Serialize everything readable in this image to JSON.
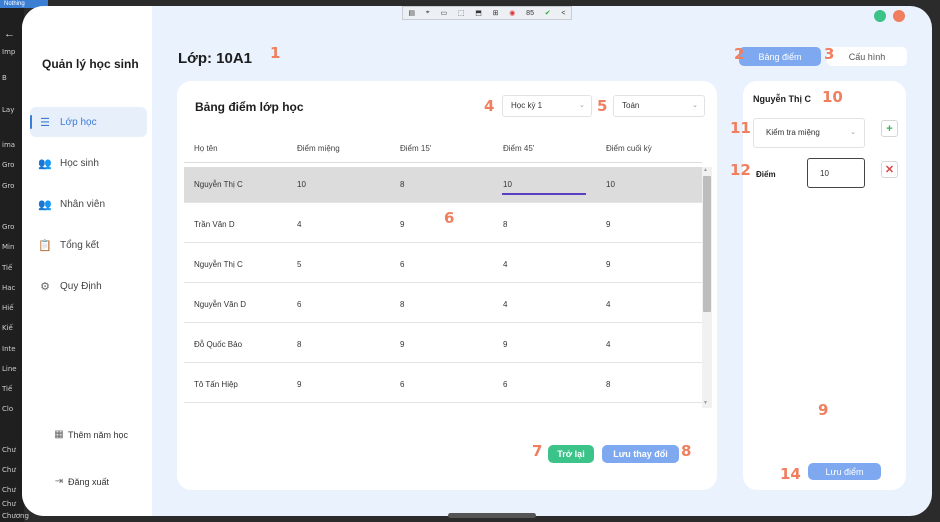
{
  "background_editor": {
    "tag": "Nothing",
    "items": [
      "Imp",
      "B",
      "Lay",
      "ima",
      "Gro",
      "Gro",
      "Gro",
      "Min",
      "Tiế",
      "Hac",
      "Hiế",
      "Kiế",
      "Inte",
      "Line",
      "Tiế",
      "Clo",
      "Chư",
      "Chư",
      "Chư",
      "Chư",
      "Chương"
    ]
  },
  "debug_toolbar": {
    "fps": "85",
    "items": [
      "▤",
      "⌖",
      "▭",
      "⬚",
      "⬒",
      "⊞",
      "◉",
      "✔",
      "<"
    ]
  },
  "window_controls": {
    "green": "#3cc389",
    "red": "#ef7f5f"
  },
  "app": {
    "title": "Quản lý học sinh"
  },
  "sidebar": {
    "items": [
      {
        "label": "Lớp học",
        "icon": "list-icon",
        "glyph": "☰",
        "active": true
      },
      {
        "label": "Học sinh",
        "icon": "student-icon",
        "glyph": "👥"
      },
      {
        "label": "Nhân viên",
        "icon": "staff-icon",
        "glyph": "👥"
      },
      {
        "label": "Tổng kết",
        "icon": "summary-icon",
        "glyph": "📋"
      },
      {
        "label": "Quy Định",
        "icon": "gear-icon",
        "glyph": "⚙"
      }
    ],
    "footer": [
      {
        "label": "Thêm năm học",
        "icon": "calendar-icon",
        "glyph": "▦"
      },
      {
        "label": "Đăng xuất",
        "icon": "logout-icon",
        "glyph": "⇥"
      }
    ]
  },
  "header": {
    "class_title": "Lớp: 10A1"
  },
  "tabs": {
    "primary": "Bảng điểm",
    "secondary": "Cấu hình"
  },
  "grade_card": {
    "title": "Bảng điểm lớp học",
    "semester_select": "Học kỳ 1",
    "subject_select": "Toán",
    "columns": [
      "Họ tên",
      "Điểm miệng",
      "Điểm 15'",
      "Điểm 45'",
      "Điểm cuối kỳ"
    ],
    "rows": [
      [
        "Nguyễn Thị C",
        "10",
        "8",
        "10",
        "10"
      ],
      [
        "Trần Văn D",
        "4",
        "9",
        "8",
        "9"
      ],
      [
        "Nguyễn Thị C",
        "5",
        "6",
        "4",
        "9"
      ],
      [
        "Nguyễn Văn D",
        "6",
        "8",
        "4",
        "4"
      ],
      [
        "Đỗ Quốc Bảo",
        "8",
        "9",
        "9",
        "4"
      ],
      [
        "Tô Tấn Hiệp",
        "9",
        "6",
        "6",
        "8"
      ]
    ],
    "back_button": "Trở lại",
    "save_changes_button": "Lưu thay đổi"
  },
  "detail_panel": {
    "student_name": "Nguyễn Thị C",
    "score_type": "Kiểm tra miệng",
    "score_label": "Điểm",
    "score_value": "10",
    "save_button": "Lưu điểm"
  },
  "annotations": {
    "n1": "1",
    "n2": "2",
    "n3": "3",
    "n4": "4",
    "n5": "5",
    "n6": "6",
    "n7": "7",
    "n8": "8",
    "n9": "9",
    "n10": "10",
    "n11": "11",
    "n12": "12",
    "n14": "14"
  }
}
